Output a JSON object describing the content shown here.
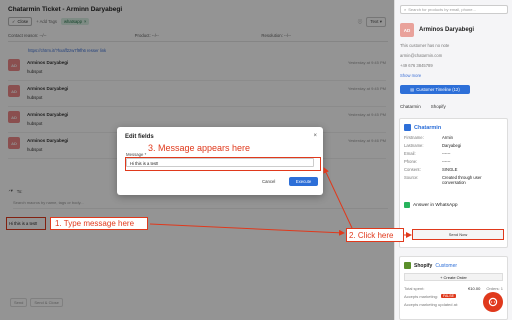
{
  "ticket": {
    "title": "Chatarmin Ticket - Arminn Daryabegi",
    "close_label": "Close",
    "add_tags_label": "+ Add Tags",
    "tag_label": "whatsapp",
    "view_mode": "Text"
  },
  "fields": {
    "contact_reason": "Contact reason: --/--",
    "product": "Product: --/--",
    "resolution": "Resolution: --/--"
  },
  "link_text": "https://chtrm.it/?hxaff2zw7f9fh6 resser link",
  "messages": [
    {
      "initials": "AD",
      "name": "Arminos Daryabegi",
      "text": "hubspot",
      "time": "Yesterday at 9:45 PM"
    },
    {
      "initials": "AD",
      "name": "Arminos Daryabegi",
      "text": "hubspot",
      "time": "Yesterday at 9:45 PM"
    },
    {
      "initials": "AD",
      "name": "Arminos Daryabegi",
      "text": "hubspot",
      "time": "Yesterday at 9:45 PM"
    },
    {
      "initials": "AD",
      "name": "Arminos Daryabegi",
      "text": "hubspot",
      "time": "Yesterday at 9:46 PM"
    }
  ],
  "compose": {
    "to_label": "To:",
    "search_placeholder": "Search macros by name, tags or body...",
    "message_value": "Hi this is a test!"
  },
  "bottom_buttons": [
    "Send",
    "Send & Close"
  ],
  "sidebar": {
    "search_placeholder": "Search for products by email, phone...",
    "contact_initials": "AD",
    "contact_name": "Arminos Daryabegi",
    "info_lines": [
      "This customer has no note",
      "armin@chatarmin.com",
      "+49 676 3845789"
    ],
    "show_more": "Show more",
    "timeline_button": "Customer Timeline (12)",
    "tabs": [
      "Chatarmin",
      "Shopify"
    ],
    "chatarmin_panel": {
      "title": "Chatarmin",
      "rows": [
        {
          "k": "Firstname:",
          "v": "Armin"
        },
        {
          "k": "Lastname:",
          "v": "Daryabegi"
        },
        {
          "k": "Email:",
          "v": "------"
        },
        {
          "k": "Phone:",
          "v": "------"
        },
        {
          "k": "Consent:",
          "v": "SINGLE"
        },
        {
          "k": "Source:",
          "v": "Created through user conversation"
        }
      ],
      "whatsapp_label": "Answer in WhatsApp",
      "send_now": "Send Now"
    },
    "shopify_panel": {
      "title": "Shopify",
      "subtitle": "Customer",
      "create_order": "+ Create Order",
      "rows": [
        {
          "k": "Total spent:",
          "v": "€10.00",
          "extra": "Orders: 1"
        },
        {
          "k": "Accepts marketing:",
          "v": "",
          "badge": "FALSE"
        },
        {
          "k": "Accepts marketing updated at:",
          "v": ""
        }
      ]
    }
  },
  "modal": {
    "title": "Edit fields",
    "close_icon": "close-icon",
    "field_label": "Message *",
    "field_value": "Hi this is a test!",
    "cancel_label": "Cancel",
    "execute_label": "Execute"
  },
  "annotations": {
    "step1": "1. Type message here",
    "step2": "2. Click here",
    "step3": "3. Message appears here",
    "color": "#e0391c"
  },
  "colors": {
    "accent_blue": "#2d6fd8",
    "annotation_red": "#e0391c",
    "whatsapp_green": "#27b35c"
  }
}
